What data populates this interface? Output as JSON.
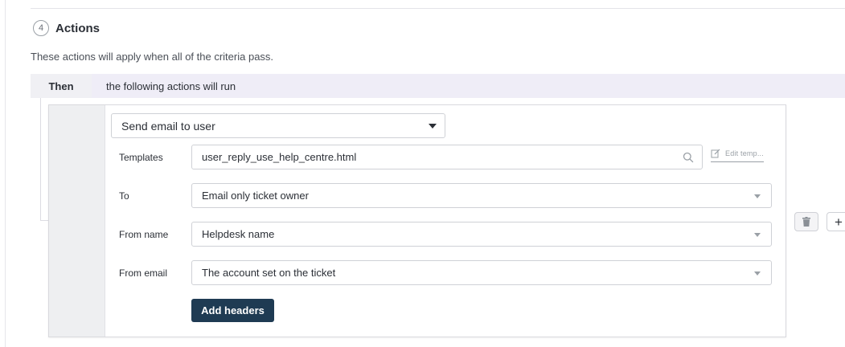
{
  "section": {
    "step_number": "4",
    "title": "Actions",
    "description": "These actions will apply when all of the criteria pass."
  },
  "then_bar": {
    "label": "Then",
    "text": "the following actions will run"
  },
  "action": {
    "selected_action": "Send email to user",
    "fields": {
      "templates": {
        "label": "Templates",
        "value": "user_reply_use_help_centre.html"
      },
      "to": {
        "label": "To",
        "value": "Email only ticket owner"
      },
      "from_name": {
        "label": "From name",
        "value": "Helpdesk name"
      },
      "from_email": {
        "label": "From email",
        "value": "The account set on the ticket"
      }
    },
    "edit_template_label": "Edit temp...",
    "add_headers_label": "Add headers"
  },
  "side_controls": {
    "add_label": "+"
  },
  "colors": {
    "primary_button": "#1f3b53",
    "then_bar_bg": "#efedf7",
    "gutter_bg": "#eeeff1"
  }
}
